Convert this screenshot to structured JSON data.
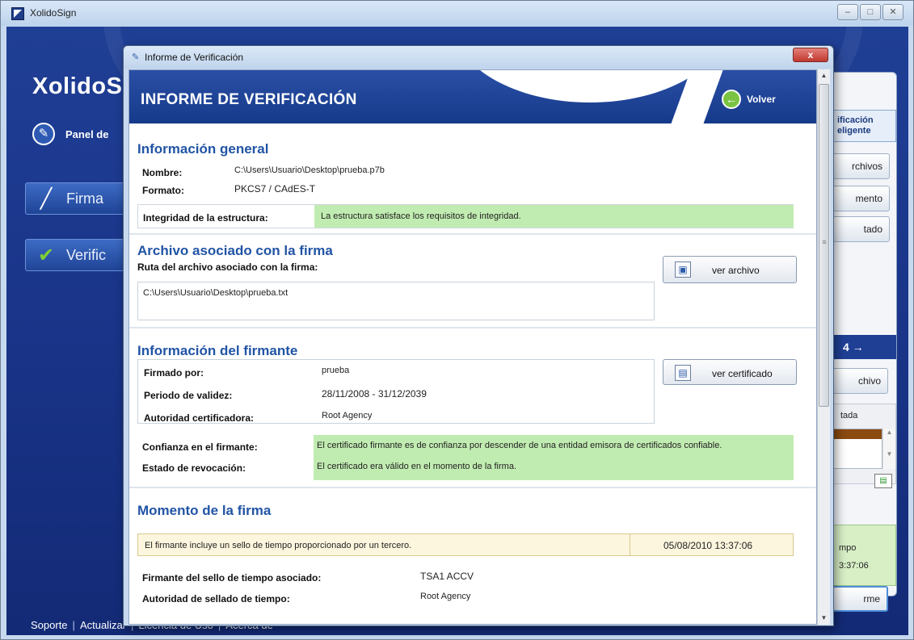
{
  "main_window": {
    "title": "XolidoSign",
    "controls": {
      "minimize": "–",
      "maximize": "□",
      "close": "✕"
    },
    "brand": "XolidoS",
    "panel_label": "Panel de",
    "side_buttons": {
      "firma": "Firma",
      "verific": "Verific"
    },
    "footer": [
      "Soporte",
      "Actualizar",
      "Licencia de Uso",
      "Acerca de"
    ],
    "footer_sep": "|"
  },
  "right_panel": {
    "top_label_1": "ificación",
    "top_label_2": "eligente",
    "archivos": "rchivos",
    "momento": "mento",
    "estado": "tado",
    "step": "4  →",
    "archivo": "chivo",
    "box_label": "tada",
    "green_line_1": "mpo",
    "green_line_2": "3:37:06",
    "informe": "rme"
  },
  "dialog": {
    "title": "Informe de Verificación",
    "close": "x",
    "report_title": "INFORME DE VERIFICACIÓN",
    "volver": "Volver",
    "general": {
      "title": "Información general",
      "nombre_label": "Nombre:",
      "nombre_value": "C:\\Users\\Usuario\\Desktop\\prueba.p7b",
      "formato_label": "Formato:",
      "formato_value": "PKCS7 / CAdES-T",
      "integridad_label": "Integridad de la estructura:",
      "integridad_value": "La estructura satisface los requisitos de integridad."
    },
    "archivo": {
      "title": "Archivo asociado con la firma",
      "ruta_label": "Ruta del archivo asociado con la firma:",
      "ruta_value": "C:\\Users\\Usuario\\Desktop\\prueba.txt",
      "ver_archivo": "ver archivo"
    },
    "firmante": {
      "title": "Información del firmante",
      "firmado_label": "Firmado por:",
      "firmado_value": "prueba",
      "periodo_label": "Periodo de validez:",
      "periodo_value": "28/11/2008 - 31/12/2039",
      "autoridad_label": "Autoridad certificadora:",
      "autoridad_value": "Root Agency",
      "ver_certificado": "ver certificado",
      "confianza_label": "Confianza en el firmante:",
      "confianza_value": "El certificado firmante es de confianza por descender de una entidad emisora de certificados confiable.",
      "revocacion_label": "Estado de revocación:",
      "revocacion_value": "El certificado era válido en el momento de la firma."
    },
    "momento": {
      "title": "Momento de la firma",
      "sello_text": "El firmante incluye un sello de tiempo proporcionado por un tercero.",
      "sello_fecha": "05/08/2010 13:37:06",
      "tsa_label": "Firmante del sello de tiempo asociado:",
      "tsa_value": "TSA1 ACCV",
      "autoridad_sellado_label": "Autoridad de sellado de tiempo:",
      "autoridad_sellado_value": "Root Agency"
    }
  }
}
